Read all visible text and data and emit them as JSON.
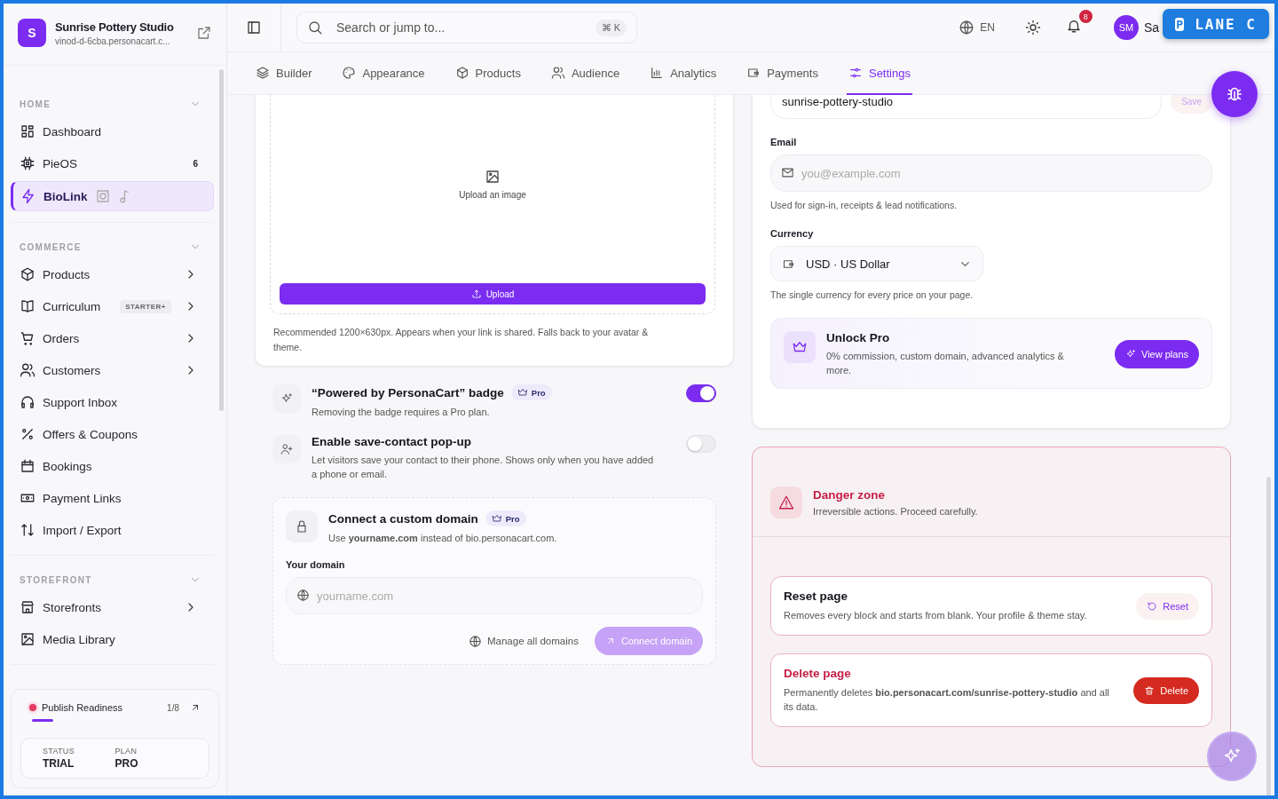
{
  "workspace": {
    "initial": "S",
    "name": "Sunrise Pottery Studio",
    "url": "vinod-d-6cba.personacart.c..."
  },
  "sidebar": {
    "sections": [
      {
        "title": "HOME",
        "expanded": true,
        "items": [
          {
            "label": "Dashboard",
            "selected": false,
            "has_submenu": false
          },
          {
            "label": "PieOS",
            "count": "6",
            "selected": false,
            "has_submenu": false
          },
          {
            "label": "BioLink",
            "selected": true,
            "has_submenu": false,
            "social_icons": true
          }
        ]
      },
      {
        "title": "COMMERCE",
        "expanded": true,
        "items": [
          {
            "label": "Products",
            "selected": false,
            "has_submenu": true
          },
          {
            "label": "Curriculum",
            "badge": "STARTER+",
            "selected": false,
            "has_submenu": true
          },
          {
            "label": "Orders",
            "selected": false,
            "has_submenu": true
          },
          {
            "label": "Customers",
            "selected": false,
            "has_submenu": true
          },
          {
            "label": "Support Inbox",
            "selected": false,
            "has_submenu": false
          },
          {
            "label": "Offers & Coupons",
            "selected": false,
            "has_submenu": false
          },
          {
            "label": "Bookings",
            "selected": false,
            "has_submenu": false
          },
          {
            "label": "Payment Links",
            "selected": false,
            "has_submenu": false
          },
          {
            "label": "Import / Export",
            "selected": false,
            "has_submenu": false
          }
        ]
      },
      {
        "title": "STOREFRONT",
        "expanded": true,
        "items": [
          {
            "label": "Storefronts",
            "selected": false,
            "has_submenu": true
          },
          {
            "label": "Media Library",
            "selected": false,
            "has_submenu": false
          }
        ]
      }
    ],
    "readiness": {
      "label": "Publish Readiness",
      "progress": "1/8",
      "level": 0.125,
      "status_label": "STATUS",
      "status": "TRIAL",
      "plan_label": "PLAN",
      "plan": "PRO"
    }
  },
  "topbar": {
    "search_placeholder": "Search or jump to...",
    "shortcut": "⌘ K",
    "language": "EN",
    "notifications": "8",
    "avatar": "SM",
    "user_name": "Sa"
  },
  "overlay_badge": {
    "letter": "P",
    "label": "LANE C"
  },
  "tabs": [
    {
      "label": "Builder",
      "selected": false
    },
    {
      "label": "Appearance",
      "selected": false
    },
    {
      "label": "Products",
      "selected": false
    },
    {
      "label": "Audience",
      "selected": false
    },
    {
      "label": "Analytics",
      "selected": false
    },
    {
      "label": "Payments",
      "selected": false
    },
    {
      "label": "Settings",
      "selected": true
    }
  ],
  "share_image": {
    "drop_label": "Upload an image",
    "button": "Upload",
    "hint": "Recommended 1200×630px. Appears when your link is shared. Falls back to your avatar & theme."
  },
  "toggles": [
    {
      "title": "“Powered by PersonaCart” badge",
      "pro": "Pro",
      "description": "Removing the badge requires a Pro plan.",
      "on": true
    },
    {
      "title": "Enable save-contact pop-up",
      "description": "Let visitors save your contact to their phone. Shows only when you have added a phone or email.",
      "on": false
    }
  ],
  "custom_domain": {
    "title": "Connect a custom domain",
    "pro": "Pro",
    "description": "Use **yourname.com** instead of bio.personacart.com.",
    "field_label": "Your domain",
    "placeholder": "yourname.com",
    "manage_link": "Manage all domains",
    "connect_button": "Connect domain",
    "connect_disabled": true
  },
  "page_settings": {
    "slug": "sunrise-pottery-studio",
    "save_button": "Save",
    "save_disabled": true,
    "email_label": "Email",
    "email_placeholder": "you@example.com",
    "email_help": "Used for sign-in, receipts & lead notifications.",
    "currency_label": "Currency",
    "currency": "USD · US Dollar",
    "currency_help": "The single currency for every price on your page."
  },
  "unlock_pro": {
    "title": "Unlock Pro",
    "description": "0% commission, custom domain, advanced analytics & more.",
    "button": "View plans"
  },
  "danger_zone": {
    "title": "Danger zone",
    "subtitle": "Irreversible actions. Proceed carefully.",
    "actions": [
      {
        "kind": "reset",
        "title": "Reset page",
        "description": "Removes every block and starts from blank. Your profile & theme stay.",
        "button": "Reset"
      },
      {
        "kind": "delete",
        "title": "Delete page",
        "description": "Permanently deletes **bio.personacart.com/sunrise-pottery-studio** and all its data.",
        "button": "Delete"
      }
    ]
  }
}
